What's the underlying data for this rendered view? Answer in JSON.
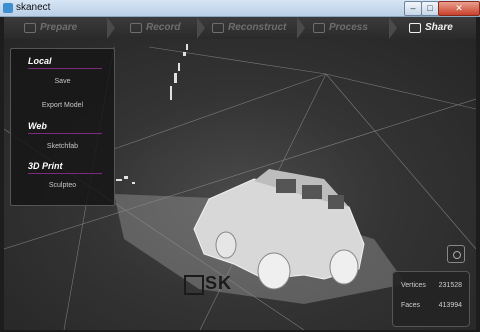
{
  "window": {
    "title": "skanect",
    "min": "–",
    "max": "□",
    "close": "✕"
  },
  "tabs": [
    {
      "label": "Prepare",
      "icon": "prepare-icon",
      "active": false
    },
    {
      "label": "Record",
      "icon": "record-icon",
      "active": false
    },
    {
      "label": "Reconstruct",
      "icon": "reconstruct-icon",
      "active": false
    },
    {
      "label": "Process",
      "icon": "process-icon",
      "active": false
    },
    {
      "label": "Share",
      "icon": "share-hand-icon",
      "active": true
    }
  ],
  "share_panel": {
    "local": {
      "heading": "Local",
      "items": [
        "Save",
        "Export Model"
      ]
    },
    "web": {
      "heading": "Web",
      "items": [
        "Sketchfab"
      ]
    },
    "print": {
      "heading": "3D Print",
      "items": [
        "Sculpteo"
      ]
    }
  },
  "stats": {
    "vertices_label": "Vertices",
    "vertices": "231528",
    "faces_label": "Faces",
    "faces": "413994"
  },
  "watermark": "SK",
  "colors": {
    "accent": "#7a2b7e",
    "active_tab": "#f0f0f0",
    "inactive_tab": "#6e6e6e"
  }
}
